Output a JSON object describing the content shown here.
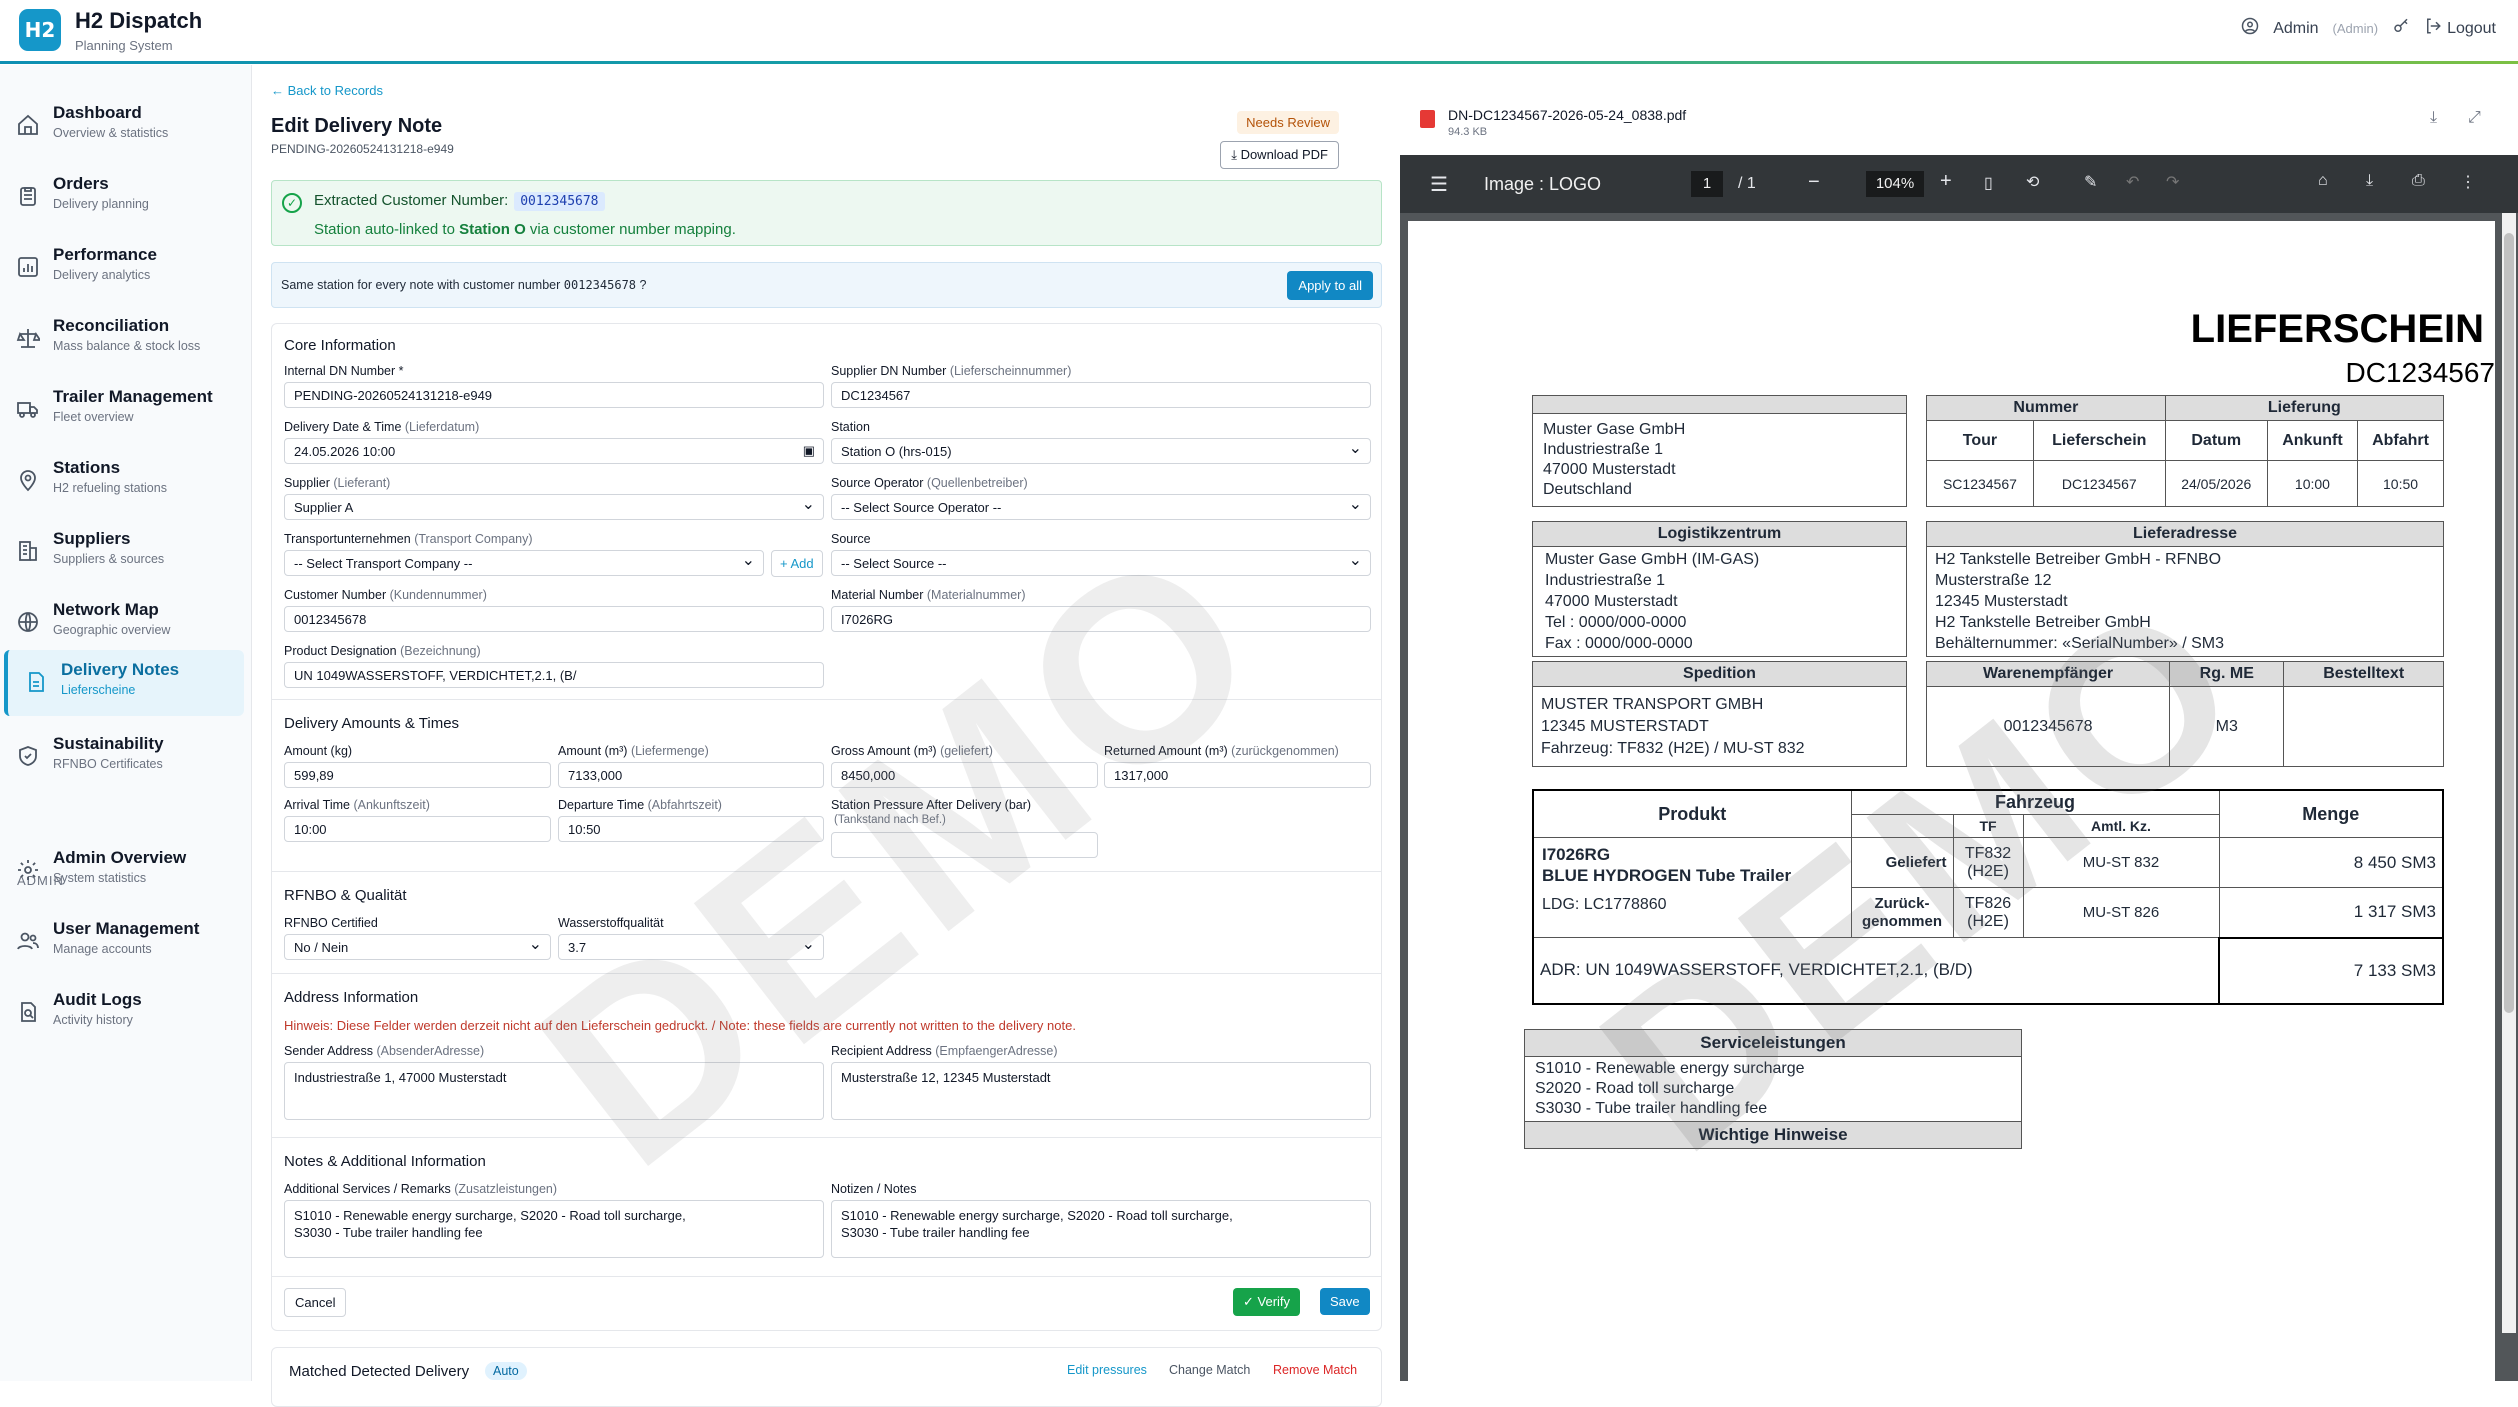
{
  "app": {
    "title": "H2 Dispatch",
    "subtitle": "Planning System",
    "logo": "H2"
  },
  "user": {
    "name": "Admin",
    "role": "(Admin)",
    "logout": "Logout"
  },
  "sidebar": {
    "items": [
      {
        "label": "Dashboard",
        "sub": "Overview & statistics",
        "icon": "home-icon"
      },
      {
        "label": "Orders",
        "sub": "Delivery planning",
        "icon": "clipboard-icon"
      },
      {
        "label": "Performance",
        "sub": "Delivery analytics",
        "icon": "chart-icon"
      },
      {
        "label": "Reconciliation",
        "sub": "Mass balance & stock loss",
        "icon": "scale-icon"
      },
      {
        "label": "Trailer Management",
        "sub": "Fleet overview",
        "icon": "truck-icon"
      },
      {
        "label": "Stations",
        "sub": "H2 refueling stations",
        "icon": "pin-icon"
      },
      {
        "label": "Suppliers",
        "sub": "Suppliers & sources",
        "icon": "building-icon"
      },
      {
        "label": "Network Map",
        "sub": "Geographic overview",
        "icon": "globe-icon"
      },
      {
        "label": "Delivery Notes",
        "sub": "Lieferscheine",
        "icon": "document-icon"
      },
      {
        "label": "Sustainability",
        "sub": "RFNBO Certificates",
        "icon": "shield-icon"
      }
    ],
    "admin_label": "ADMIN",
    "admin_items": [
      {
        "label": "Admin Overview",
        "sub": "System statistics",
        "icon": "gear-icon"
      },
      {
        "label": "User Management",
        "sub": "Manage accounts",
        "icon": "users-icon"
      },
      {
        "label": "Audit Logs",
        "sub": "Activity history",
        "icon": "audit-icon"
      }
    ]
  },
  "page": {
    "back": "← Back to Records",
    "title": "Edit Delivery Note",
    "id": "PENDING-20260524131218-e949",
    "status": "Needs Review",
    "download": "Download PDF"
  },
  "extract": {
    "label": "Extracted Customer Number:",
    "number": "0012345678",
    "linked_pre": "Station auto-linked to ",
    "linked_station": "Station O",
    "linked_post": " via customer number mapping."
  },
  "same_station": {
    "pre": "Same station for every note with customer number ",
    "number": "0012345678",
    "post": "?",
    "button": "Apply to all"
  },
  "core": {
    "title": "Core Information",
    "internal_dn_label": "Internal DN Number *",
    "internal_dn": "PENDING-20260524131218-e949",
    "supplier_dn_label": "Supplier DN Number",
    "supplier_dn_hint": "(Lieferscheinnummer)",
    "supplier_dn": "DC1234567",
    "date_label": "Delivery Date & Time",
    "date_hint": "(Lieferdatum)",
    "date": "24.05.2026 10:00",
    "station_label": "Station",
    "station": "Station O (hrs-015)",
    "supplier_label": "Supplier",
    "supplier_hint": "(Lieferant)",
    "supplier": "Supplier A",
    "source_op_label": "Source Operator",
    "source_op_hint": "(Quellenbetreiber)",
    "source_op": "-- Select Source Operator --",
    "transport_label": "Transportunternehmen",
    "transport_hint": "(Transport Company)",
    "transport": "-- Select Transport Company --",
    "add": "+ Add",
    "source_label": "Source",
    "source": "-- Select Source --",
    "customer_label": "Customer Number",
    "customer_hint": "(Kundennummer)",
    "customer": "0012345678",
    "material_label": "Material Number",
    "material_hint": "(Materialnummer)",
    "material": "I7026RG",
    "product_label": "Product Designation",
    "product_hint": "(Bezeichnung)",
    "product": "UN 1049WASSERSTOFF, VERDICHTET,2.1, (B/"
  },
  "amounts": {
    "title": "Delivery Amounts & Times",
    "kg_label": "Amount (kg)",
    "kg": "599,89",
    "m3_label": "Amount (m³)",
    "m3_hint": "(Liefermenge)",
    "m3": "7133,000",
    "gross_label": "Gross Amount (m³)",
    "gross_hint": "(geliefert)",
    "gross": "8450,000",
    "returned_label": "Returned Amount (m³)",
    "returned_hint": "(zurückgenommen)",
    "returned": "1317,000",
    "arrival_label": "Arrival Time",
    "arrival_hint": "(Ankunftszeit)",
    "arrival": "10:00",
    "departure_label": "Departure Time",
    "departure_hint": "(Abfahrtszeit)",
    "departure": "10:50",
    "pressure_label": "Station Pressure After Delivery (bar)",
    "pressure_hint": "(Tankstand nach Bef.)",
    "pressure": ""
  },
  "rfnbo": {
    "title": "RFNBO & Qualität",
    "cert_label": "RFNBO Certified",
    "cert": "No / Nein",
    "quality_label": "Wasserstoffqualität",
    "quality": "3.7"
  },
  "address": {
    "title": "Address Information",
    "hint": "Hinweis: Diese Felder werden derzeit nicht auf den Lieferschein gedruckt. / Note: these fields are currently not written to the delivery note.",
    "sender_label": "Sender Address",
    "sender_hint": "(AbsenderAdresse)",
    "sender": "Industriestraße 1, 47000 Musterstadt",
    "recipient_label": "Recipient Address",
    "recipient_hint": "(EmpfaengerAdresse)",
    "recipient": "Musterstraße 12, 12345 Musterstadt"
  },
  "notes": {
    "title": "Notes & Additional Information",
    "services_label": "Additional Services / Remarks",
    "services_hint": "(Zusatzleistungen)",
    "services": "S1010 - Renewable energy surcharge, S2020 - Road toll surcharge,\nS3030 - Tube trailer handling fee",
    "notes_label": "Notizen / Notes",
    "notes": "S1010 - Renewable energy surcharge, S2020 - Road toll surcharge,\nS3030 - Tube trailer handling fee"
  },
  "actions": {
    "cancel": "Cancel",
    "verify": "✓ Verify",
    "save": "Save"
  },
  "matched": {
    "title": "Matched Detected Delivery",
    "badge": "Auto",
    "edit": "Edit pressures",
    "change": "Change Match",
    "remove": "Remove Match"
  },
  "watermark": "DEMO",
  "viewer": {
    "filename": "DN-DC1234567-2026-05-24_0838.pdf",
    "size": "94.3 KB",
    "doc_title": "Image : LOGO",
    "page": "1",
    "pages": "/ 1",
    "zoom": "104%"
  },
  "pdf": {
    "title": "LIEFERSCHEIN",
    "number": "DC1234567",
    "sender": [
      "Muster Gase GmbH",
      "Industriestraße 1",
      "47000 Musterstadt",
      "Deutschland"
    ],
    "h_nummer": "Nummer",
    "h_lieferung": "Lieferung",
    "h_tour": "Tour",
    "h_lieferschein": "Lieferschein",
    "h_datum": "Datum",
    "h_ankunft": "Ankunft",
    "h_abfahrt": "Abfahrt",
    "tour": "SC1234567",
    "lieferschein": "DC1234567",
    "datum": "24/05/2026",
    "ankunft": "10:00",
    "abfahrt": "10:50",
    "h_logistik": "Logistikzentrum",
    "logistik": [
      "Muster Gase GmbH (IM-GAS)",
      "Industriestraße 1",
      "47000 Musterstadt",
      "Tel :  0000/000-0000",
      "Fax :  0000/000-0000"
    ],
    "h_lieferadresse": "Lieferadresse",
    "lieferadresse": [
      "H2 Tankstelle Betreiber GmbH  - RFNBO",
      "Musterstraße 12",
      "12345 Musterstadt",
      "H2 Tankstelle Betreiber GmbH",
      "Behälternummer: «SerialNumber» / SM3"
    ],
    "h_spedition": "Spedition",
    "spedition": [
      "MUSTER TRANSPORT GMBH",
      "12345 MUSTERSTADT",
      "Fahrzeug: TF832 (H2E) / MU-ST 832"
    ],
    "h_warenempf": "Warenempfänger",
    "h_rgme": "Rg. ME",
    "h_bestell": "Bestelltext",
    "warenempf": "0012345678",
    "rgme": "M3",
    "h_produkt": "Produkt",
    "h_fahrzeug": "Fahrzeug",
    "h_tf": "TF",
    "h_kz": "Amtl. Kz.",
    "h_menge": "Menge",
    "produkt_code": "I7026RG",
    "produkt_name": "BLUE HYDROGEN Tube Trailer",
    "ldg": "LDG: LC1778860",
    "geliefert": "Geliefert",
    "g_tf": "TF832\n(H2E)",
    "g_kz": "MU-ST 832",
    "g_menge": "8 450  SM3",
    "zurueck": "Zurück-\ngenommen",
    "z_tf": "TF826\n(H2E)",
    "z_kz": "MU-ST 826",
    "z_menge": "1 317  SM3",
    "adr": "ADR: UN 1049WASSERSTOFF, VERDICHTET,2.1, (B/D)",
    "total": "7 133  SM3",
    "h_service": "Serviceleistungen",
    "services": [
      "S1010 - Renewable energy surcharge",
      "S2020 - Road toll surcharge",
      "S3030 - Tube trailer handling fee"
    ],
    "h_hinweise": "Wichtige Hinweise"
  }
}
